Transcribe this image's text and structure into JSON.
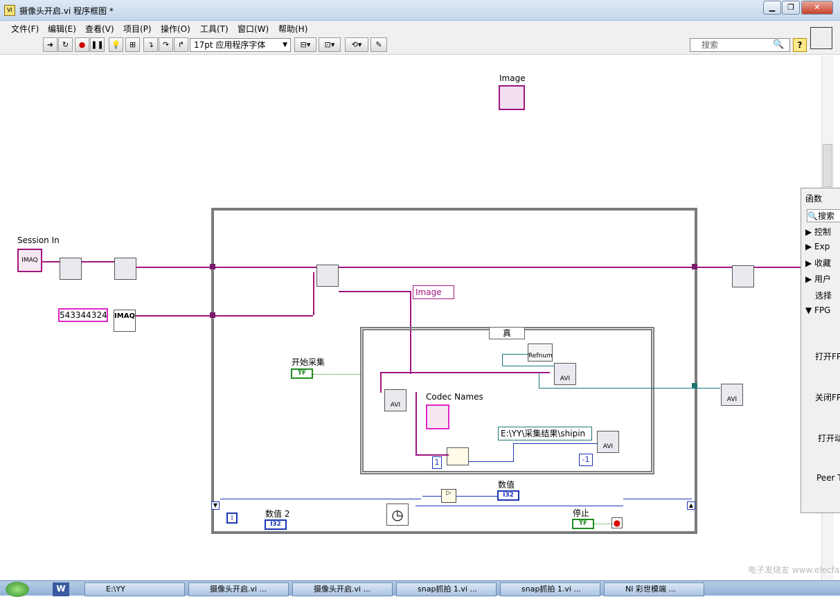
{
  "window": {
    "title": "摄像头开启.vi 程序框图 *",
    "buttons": [
      "minimize",
      "restore",
      "close"
    ]
  },
  "menu": [
    "文件(F)",
    "编辑(E)",
    "查看(V)",
    "项目(P)",
    "操作(O)",
    "工具(T)",
    "窗口(W)",
    "帮助(H)"
  ],
  "toolbar": {
    "font": "17pt 应用程序字体",
    "search_placeholder": "搜索",
    "help": "?"
  },
  "diagram": {
    "image_indicator": "Image",
    "session_in": "Session In",
    "constant_value": "543344324",
    "image_property": "Image",
    "case_value": "真",
    "start_label": "开始采集",
    "codec_label": "Codec Names",
    "refnum": "Refnum",
    "path": "E:\\YY\\采集结果\\shipin",
    "const_one": "1",
    "const_neg": "-1",
    "numeric_label": "数值",
    "numeric_type": "I32",
    "numeric2_label": "数值 2",
    "numeric2_type": "I32",
    "stop_label": "停止",
    "bool_tf": "TF",
    "iteration": "i",
    "avi": "AVI",
    "imaq": "IMAQ"
  },
  "palette": {
    "title": "函数",
    "search": "搜索",
    "items": [
      "控制",
      "Exp",
      "收藏",
      "用户",
      "选择",
      "FPG"
    ],
    "labels": [
      "打开FP",
      "关闭FP",
      "打开动",
      "Peer T"
    ]
  },
  "taskbar": {
    "items": [
      "E:\\YY",
      "摄像头开启.vi ...",
      "摄像头开启.vi ...",
      "snap抓拍 1.vi ...",
      "snap抓拍 1.vi ...",
      "NI 彩世模端 ..."
    ]
  },
  "watermark": "电子发烧友 www.elecfans.com"
}
